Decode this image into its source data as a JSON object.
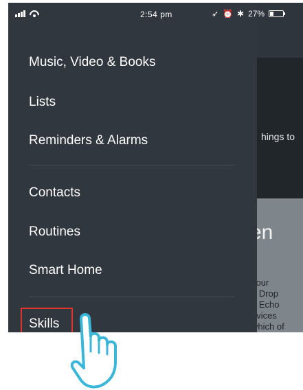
{
  "status_bar": {
    "time": "2:54 pm",
    "battery": "27%",
    "battery_level": 0.27
  },
  "menu": {
    "items": [
      {
        "label": "Music, Video & Books"
      },
      {
        "label": "Lists"
      },
      {
        "label": "Reminders & Alarms"
      },
      {
        "label": "Contacts"
      },
      {
        "label": "Routines"
      },
      {
        "label": "Smart Home"
      },
      {
        "label": "Skills",
        "highlighted": true
      }
    ]
  },
  "background": {
    "hint_text": "hings to",
    "heading": "en",
    "paragraph_lines": [
      "your",
      "n Drop",
      "n Echo",
      "evices",
      "which of"
    ]
  },
  "colors": {
    "drawer": "#31373e",
    "highlight": "#e0322e",
    "hand_outline": "#39b6d8"
  },
  "icons": [
    "signal-icon",
    "wifi-icon",
    "location-icon",
    "alarm-icon",
    "bluetooth-icon",
    "battery-icon",
    "pointing-hand-icon"
  ]
}
